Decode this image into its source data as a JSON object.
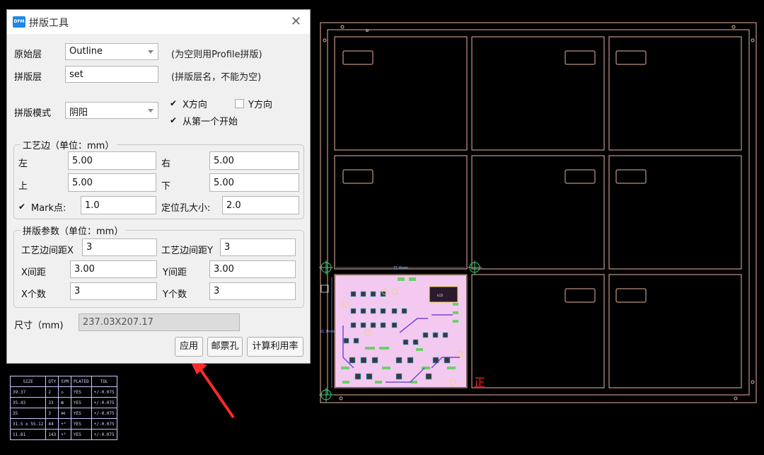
{
  "dialog": {
    "title": "拼版工具",
    "logo_text": "DFM",
    "close_glyph": "✕",
    "source_layer": {
      "label": "原始层",
      "value": "Outline",
      "hint": "(为空则用Profile拼版)"
    },
    "panel_layer": {
      "label": "拼版层",
      "value": "set",
      "hint": "(拼版层名，不能为空)"
    },
    "mode": {
      "label": "拼版模式",
      "value": "阴阳"
    },
    "x_dir": {
      "label": "X方向",
      "checked": true
    },
    "y_dir": {
      "label": "Y方向",
      "checked": false
    },
    "from_first": {
      "label": "从第一个开始",
      "checked": true
    },
    "margin_group": {
      "title": "工艺边（单位：mm）",
      "left_label": "左",
      "left_value": "5.00",
      "right_label": "右",
      "right_value": "5.00",
      "top_label": "上",
      "top_value": "5.00",
      "bottom_label": "下",
      "bottom_value": "5.00",
      "mark_label": "Mark点:",
      "mark_checked": true,
      "mark_value": "1.0",
      "hole_label": "定位孔大小:",
      "hole_value": "2.0"
    },
    "panel_group": {
      "title": "拼版参数（单位：mm）",
      "edge_x_label": "工艺边间距X",
      "edge_x_value": "3",
      "edge_y_label": "工艺边间距Y",
      "edge_y_value": "3",
      "x_gap_label": "X间距",
      "x_gap_value": "3.00",
      "y_gap_label": "Y间距",
      "y_gap_value": "3.00",
      "x_count_label": "X个数",
      "x_count_value": "3",
      "y_count_label": "Y个数",
      "y_count_value": "3"
    },
    "size": {
      "label": "尺寸（mm)",
      "value": "237.03X207.17"
    },
    "buttons": {
      "apply": "应用",
      "stamp_hole": "邮票孔",
      "calc_util": "计算利用率"
    }
  },
  "drill_table": {
    "headers": [
      "SIZE",
      "QTY",
      "SYM",
      "PLATED",
      "TOL"
    ],
    "rows": [
      [
        "39.37",
        "2",
        "◇",
        "YES",
        "+/-0.075"
      ],
      [
        "35.43",
        "33",
        "⊠",
        "YES",
        "+/-0.075"
      ],
      [
        "35",
        "3",
        "⋈",
        "YES",
        "+/-0.075"
      ],
      [
        "31.5 x 55.12",
        "44",
        "+²",
        "YES",
        "+/-0.075"
      ],
      [
        "11.81",
        "143",
        "+¹",
        "YES",
        "+/-0.075"
      ]
    ]
  },
  "pcb": {
    "dimension_label": "71.0mm",
    "side_dim_label": "51.7mm",
    "front_mark": "正",
    "outline_color": "#e8b4a0",
    "board_color": "#f3c9f0"
  }
}
